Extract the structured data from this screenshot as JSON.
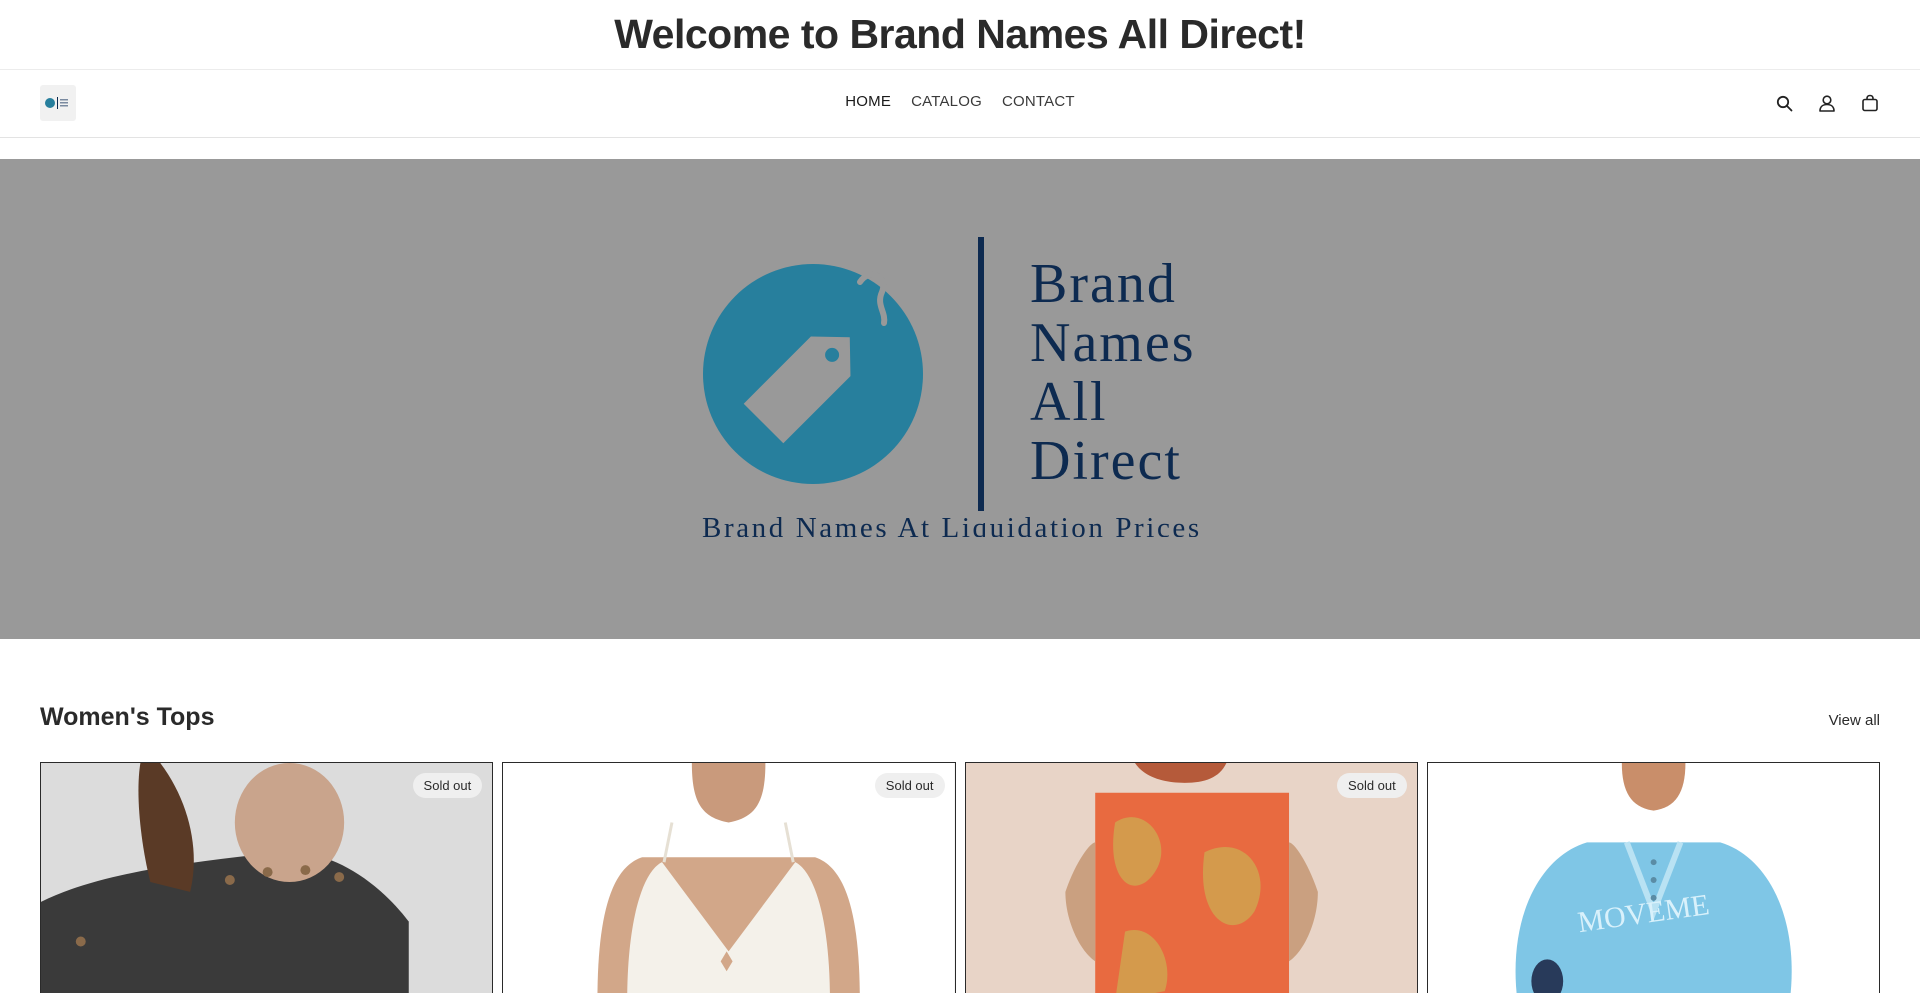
{
  "announcement": {
    "text": "Welcome to Brand Names All Direct!"
  },
  "header": {
    "logo_alt": "Brand Names All Direct logo",
    "nav": [
      {
        "label": "HOME",
        "active": true
      },
      {
        "label": "CATALOG",
        "active": false
      },
      {
        "label": "CONTACT",
        "active": false
      }
    ],
    "icons": [
      "search-icon",
      "account-icon",
      "cart-icon"
    ]
  },
  "hero": {
    "brand_lines": [
      "Brand",
      "Names",
      "All",
      "Direct"
    ],
    "tagline": "Brand Names At Liquidation Prices",
    "background": "#999999",
    "brand_blue": "#277f9d",
    "text_navy": "#0d2a50"
  },
  "collection": {
    "title": "Women's Tops",
    "view_all": "View all",
    "products": [
      {
        "badge": "Sold out",
        "colors": [
          "#d8d8d8",
          "#3a3a3a"
        ]
      },
      {
        "badge": "Sold out",
        "colors": [
          "#ffffff",
          "#f2efe8"
        ]
      },
      {
        "badge": "Sold out",
        "colors": [
          "#e7d3c6",
          "#e36a40"
        ]
      },
      {
        "badge": "",
        "colors": [
          "#ffffff",
          "#7fc6e6"
        ]
      }
    ]
  }
}
